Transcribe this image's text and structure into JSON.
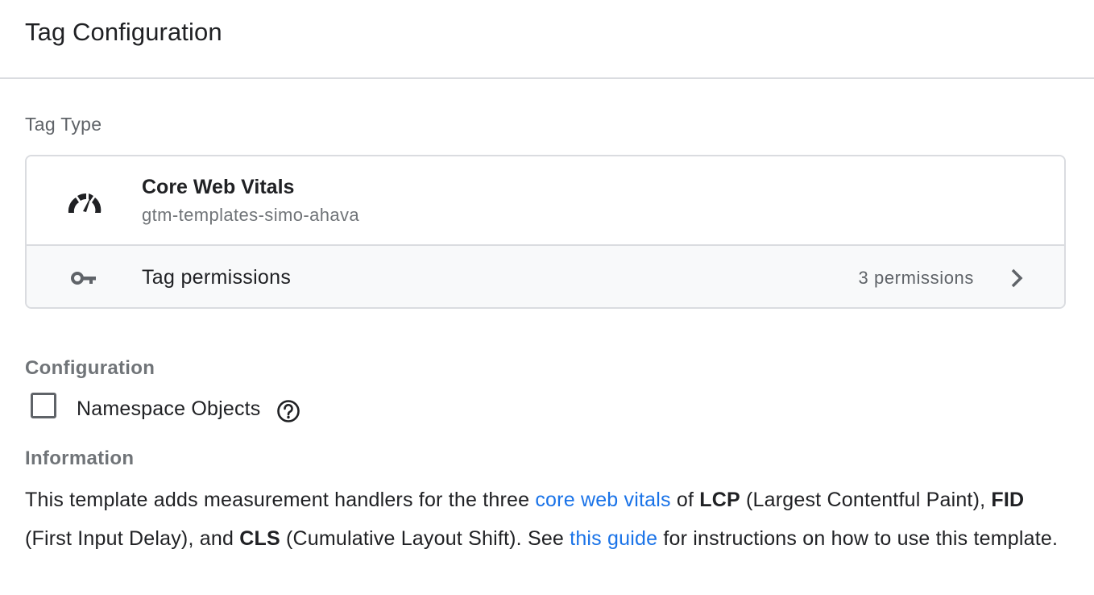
{
  "header": {
    "title": "Tag Configuration"
  },
  "tag_type": {
    "section_label": "Tag Type",
    "template_name": "Core Web Vitals",
    "template_author": "gtm-templates-simo-ahava",
    "template_icon": "gauge-icon",
    "permissions_label": "Tag permissions",
    "permissions_count": "3 permissions",
    "permissions_icon": "key-icon"
  },
  "configuration": {
    "section_label": "Configuration",
    "namespace_label": "Namespace Objects",
    "namespace_checked": false
  },
  "information": {
    "section_label": "Information",
    "t1": "This template adds measurement handlers for the three ",
    "link1": "core web vitals",
    "t2": " of ",
    "b1": "LCP",
    "t3": " (Largest Contentful Paint), ",
    "b2": "FID",
    "t4": " (First Input Delay), and ",
    "b3": "CLS",
    "t5": " (Cumulative Layout Shift). See ",
    "link2": "this guide",
    "t6": " for instructions on how to use this template."
  },
  "colors": {
    "link": "#1a73e8",
    "border": "#dadce0",
    "muted_text": "#5f6368"
  }
}
